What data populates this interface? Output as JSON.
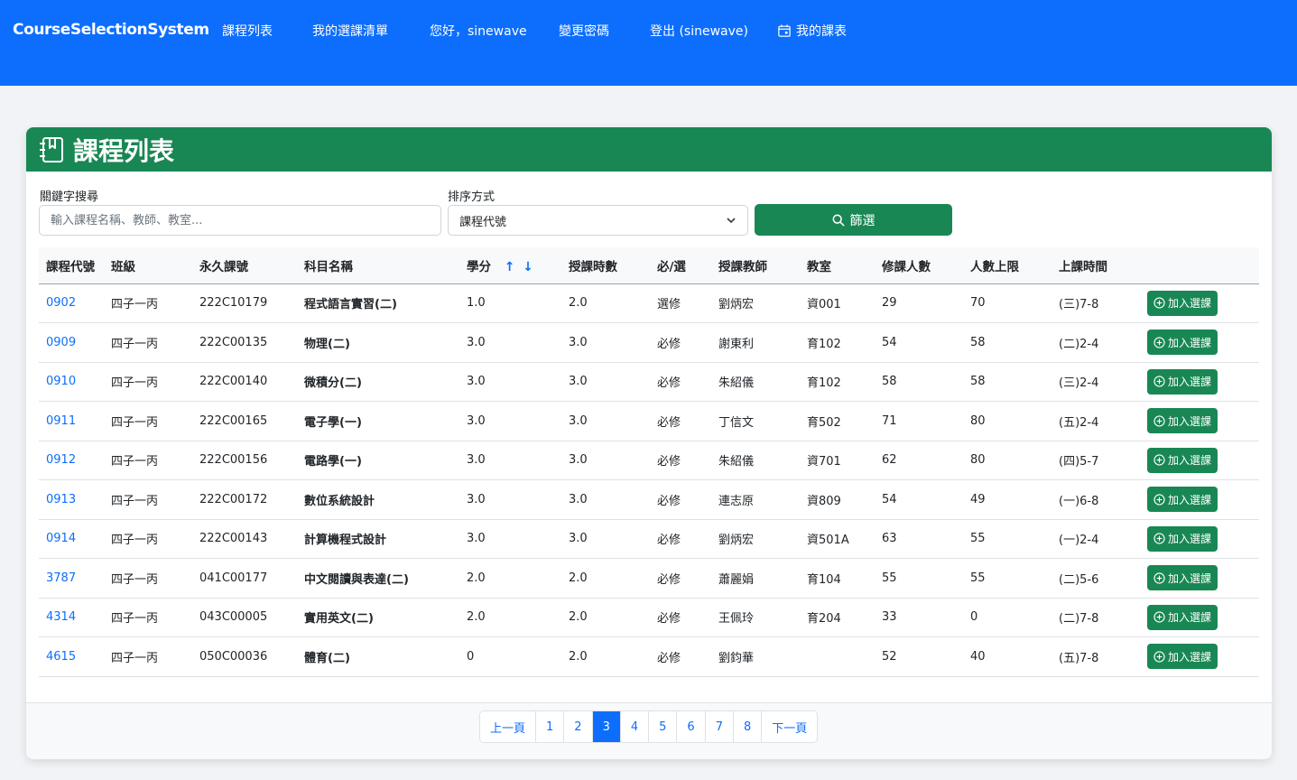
{
  "navbar": {
    "brand": "CourseSelectionSystem",
    "items": [
      "課程列表",
      "我的選課清單",
      "您好，sinewave",
      "變更密碼",
      "登出 (sinewave)"
    ],
    "schedule_label": "我的課表",
    "schedule_icon": "calendar-icon"
  },
  "card": {
    "title": "課程列表",
    "title_icon": "journal-bookmark-icon",
    "search_label": "關鍵字搜尋",
    "search_placeholder": "輸入課程名稱、教師、教室...",
    "search_value": "",
    "sort_label": "排序方式",
    "sort_value": "課程代號",
    "filter_label": "篩選",
    "filter_icon": "search-icon"
  },
  "table": {
    "headers": [
      "課程代號",
      "班級",
      "永久課號",
      "科目名稱",
      "學分",
      "授課時數",
      "必/選",
      "授課教師",
      "教室",
      "修課人數",
      "人數上限",
      "上課時間",
      ""
    ],
    "sort_asc": "↑",
    "sort_desc": "↓",
    "add_label": "加入選課",
    "rows": [
      [
        "0902",
        "四子一丙",
        "222C10179",
        "程式語言實習(二)",
        "1.0",
        "2.0",
        "選修",
        "劉炳宏",
        "資001",
        "29",
        "70",
        "(三)7-8"
      ],
      [
        "0909",
        "四子一丙",
        "222C00135",
        "物理(二)",
        "3.0",
        "3.0",
        "必修",
        "謝東利",
        "育102",
        "54",
        "58",
        "(二)2-4"
      ],
      [
        "0910",
        "四子一丙",
        "222C00140",
        "微積分(二)",
        "3.0",
        "3.0",
        "必修",
        "朱紹儀",
        "育102",
        "58",
        "58",
        "(三)2-4"
      ],
      [
        "0911",
        "四子一丙",
        "222C00165",
        "電子學(一)",
        "3.0",
        "3.0",
        "必修",
        "丁信文",
        "育502",
        "71",
        "80",
        "(五)2-4"
      ],
      [
        "0912",
        "四子一丙",
        "222C00156",
        "電路學(一)",
        "3.0",
        "3.0",
        "必修",
        "朱紹儀",
        "資701",
        "62",
        "80",
        "(四)5-7"
      ],
      [
        "0913",
        "四子一丙",
        "222C00172",
        "數位系統設計",
        "3.0",
        "3.0",
        "必修",
        "連志原",
        "資809",
        "54",
        "49",
        "(一)6-8"
      ],
      [
        "0914",
        "四子一丙",
        "222C00143",
        "計算機程式設計",
        "3.0",
        "3.0",
        "必修",
        "劉炳宏",
        "資501A",
        "63",
        "55",
        "(一)2-4"
      ],
      [
        "3787",
        "四子一丙",
        "041C00177",
        "中文閱讀與表達(二)",
        "2.0",
        "2.0",
        "必修",
        "蕭麗娟",
        "育104",
        "55",
        "55",
        "(二)5-6"
      ],
      [
        "4314",
        "四子一丙",
        "043C00005",
        "實用英文(二)",
        "2.0",
        "2.0",
        "必修",
        "王佩玲",
        "育204",
        "33",
        "0",
        "(二)7-8"
      ],
      [
        "4615",
        "四子一丙",
        "050C00036",
        "體育(二)",
        "0",
        "2.0",
        "必修",
        "劉鈞華",
        "",
        "52",
        "40",
        "(五)7-8"
      ]
    ]
  },
  "pagination": {
    "prev": "上一頁",
    "next": "下一頁",
    "pages": [
      "1",
      "2",
      "3",
      "4",
      "5",
      "6",
      "7",
      "8"
    ],
    "current": "3"
  }
}
